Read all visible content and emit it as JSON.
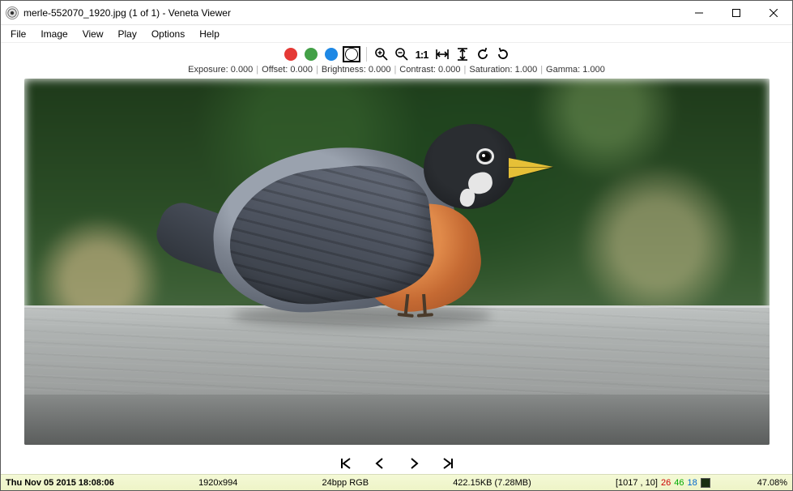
{
  "title": "merle-552070_1920.jpg (1 of 1) - Veneta Viewer",
  "menu": {
    "file": "File",
    "image": "Image",
    "view": "View",
    "play": "Play",
    "options": "Options",
    "help": "Help"
  },
  "toolbar": {
    "icons": {
      "red": "red-channel",
      "green": "green-channel",
      "blue": "blue-channel",
      "bw": "grayscale",
      "zoomin": "zoom-in",
      "zoomout": "zoom-out",
      "actual": "1:1",
      "fitw": "fit-width",
      "fith": "fit-height",
      "rotl": "rotate-left",
      "rotr": "rotate-right"
    }
  },
  "params": {
    "exposure_label": "Exposure:",
    "exposure": "0.000",
    "offset_label": "Offset:",
    "offset": "0.000",
    "brightness_label": "Brightness:",
    "brightness": "0.000",
    "contrast_label": "Contrast:",
    "contrast": "0.000",
    "saturation_label": "Saturation:",
    "saturation": "1.000",
    "gamma_label": "Gamma:",
    "gamma": "1.000"
  },
  "nav": {
    "first": "first",
    "prev": "previous",
    "next": "next",
    "last": "last"
  },
  "status": {
    "datetime": "Thu Nov 05 2015 18:08:06",
    "dimensions": "1920x994",
    "depth": "24bpp RGB",
    "filesize": "422.15KB (7.28MB)",
    "cursor": "[1017 , 10]",
    "r": "26",
    "g": "46",
    "b": "18",
    "swatch": "#1a2e12",
    "zoom": "47.08%"
  }
}
